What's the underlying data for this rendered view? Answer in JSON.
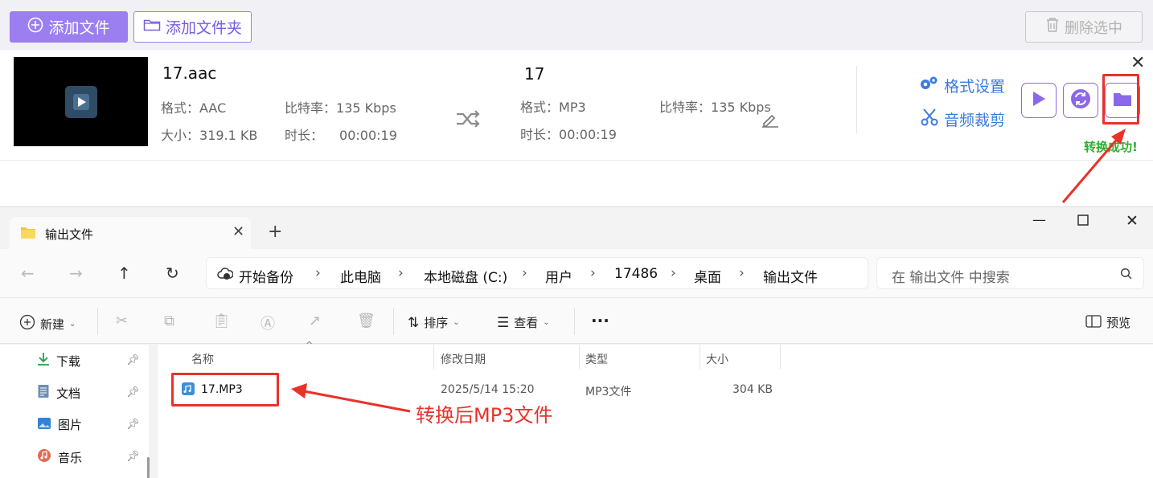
{
  "app": {
    "add_file": "添加文件",
    "add_folder": "添加文件夹",
    "delete_selected": "删除选中",
    "source": {
      "name": "17.aac",
      "format_label": "格式：",
      "format": "AAC",
      "bitrate_label": "比特率：",
      "bitrate": "135 Kbps",
      "size_label": "大小：",
      "size": "319.1 KB",
      "duration_label": "时长：",
      "duration": "00:00:19"
    },
    "output": {
      "name": "17",
      "format_label": "格式：",
      "format": "MP3",
      "bitrate_label": "比特率：",
      "bitrate": "135 Kbps",
      "duration_label": "时长：",
      "duration": "00:00:19"
    },
    "format_settings": "格式设置",
    "audio_trim": "音频裁剪",
    "status": "转换成功!",
    "colors": {
      "accent": "#9b7ff0",
      "link": "#3a7be0",
      "success": "#2fae2f",
      "annotation": "#e8322a"
    }
  },
  "explorer": {
    "tab_title": "输出文件",
    "breadcrumbs": [
      "开始备份",
      "此电脑",
      "本地磁盘 (C:)",
      "用户",
      "17486",
      "桌面",
      "输出文件"
    ],
    "search_placeholder": "在 输出文件 中搜索",
    "toolbar": {
      "new": "新建",
      "sort": "排序",
      "view": "查看",
      "more": "···",
      "preview": "预览"
    },
    "sidebar": [
      {
        "label": "下载",
        "icon": "download-icon"
      },
      {
        "label": "文档",
        "icon": "document-icon"
      },
      {
        "label": "图片",
        "icon": "picture-icon"
      },
      {
        "label": "音乐",
        "icon": "music-icon"
      }
    ],
    "columns": {
      "name": "名称",
      "modified": "修改日期",
      "type": "类型",
      "size": "大小"
    },
    "files": [
      {
        "name": "17.MP3",
        "modified": "2025/5/14 15:20",
        "type": "MP3文件",
        "size": "304 KB"
      }
    ]
  },
  "annotation": {
    "label": "转换后MP3文件"
  }
}
